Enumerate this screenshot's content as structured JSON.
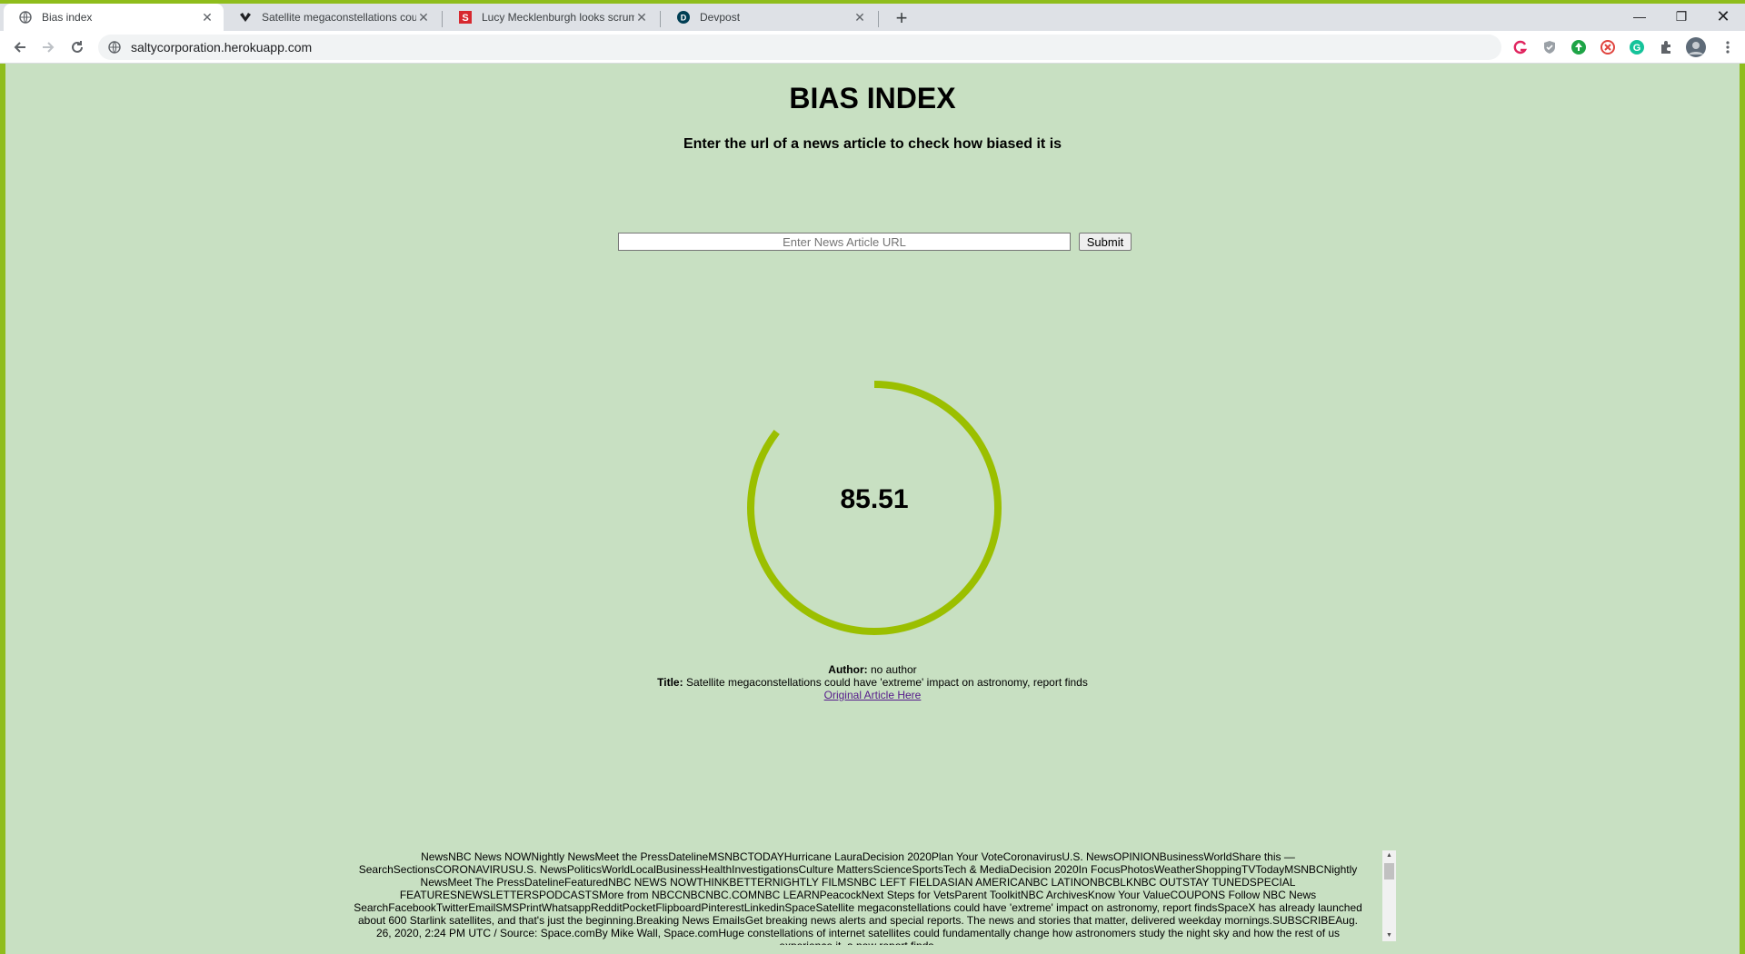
{
  "browser": {
    "tabs": [
      {
        "title": "Bias index",
        "favicon": "globe-icon",
        "active": true
      },
      {
        "title": "Satellite megaconstellations coul",
        "favicon": "nbc-peacock-icon",
        "active": false
      },
      {
        "title": "Lucy Mecklenburgh looks scrump",
        "favicon": "s-logo-icon",
        "active": false
      },
      {
        "title": "Devpost",
        "favicon": "devpost-icon",
        "active": false
      }
    ],
    "address_bar": {
      "url": "saltycorporation.herokuapp.com"
    },
    "colors": {
      "window_frame": "#8fbd1c",
      "tab_strip": "#dee1e6"
    }
  },
  "page": {
    "title": "BIAS INDEX",
    "subtitle": "Enter the url of a news article to check how biased it is",
    "url_input": {
      "placeholder": "Enter News Article URL",
      "value": ""
    },
    "submit_label": "Submit",
    "score": {
      "value": "85.51",
      "fill_fraction": 0.855
    },
    "author_label": "Author:",
    "author_value": "no author",
    "title_label": "Title:",
    "title_value": "Satellite megaconstellations could have 'extreme' impact on astronomy, report finds",
    "original_link": "Original Article Here",
    "article_text": "NewsNBC News NOWNightly NewsMeet the PressDatelineMSNBCTODAYHurricane LauraDecision 2020Plan Your VoteCoronavirusU.S. NewsOPINIONBusinessWorldShare this —SearchSectionsCORONAVIRUSU.S. NewsPoliticsWorldLocalBusinessHealthInvestigationsCulture MattersScienceSportsTech & MediaDecision 2020In FocusPhotosWeatherShoppingTVTodayMSNBCNightly NewsMeet The PressDatelineFeaturedNBC NEWS NOWTHINKBETTERNIGHTLY FILMSNBC LEFT FIELDASIAN AMERICANBC LATINONBCBLKNBC OUTSTAY TUNEDSPECIAL FEATURESNEWSLETTERSPODCASTSMore from NBCCNBCNBC.COMNBC LEARNPeacockNext Steps for VetsParent ToolkitNBC ArchivesKnow Your ValueCOUPONS Follow NBC News SearchFacebookTwitterEmailSMSPrintWhatsappRedditPocketFlipboardPinterestLinkedinSpaceSatellite megaconstellations could have 'extreme' impact on astronomy, report findsSpaceX has already launched about 600 Starlink satellites, and that's just the beginning.Breaking News EmailsGet breaking news alerts and special reports. The news and stories that matter, delivered weekday mornings.SUBSCRIBEAug. 26, 2020, 2:24 PM UTC / Source: Space.comBy Mike Wall, Space.comHuge constellations of internet satellites could fundamentally change how astronomers study the night sky and how the rest of us experience it, a new report finds.",
    "colors": {
      "background": "#c8e0c2",
      "gauge": "#9bbf00",
      "link": "#551a8b"
    }
  }
}
